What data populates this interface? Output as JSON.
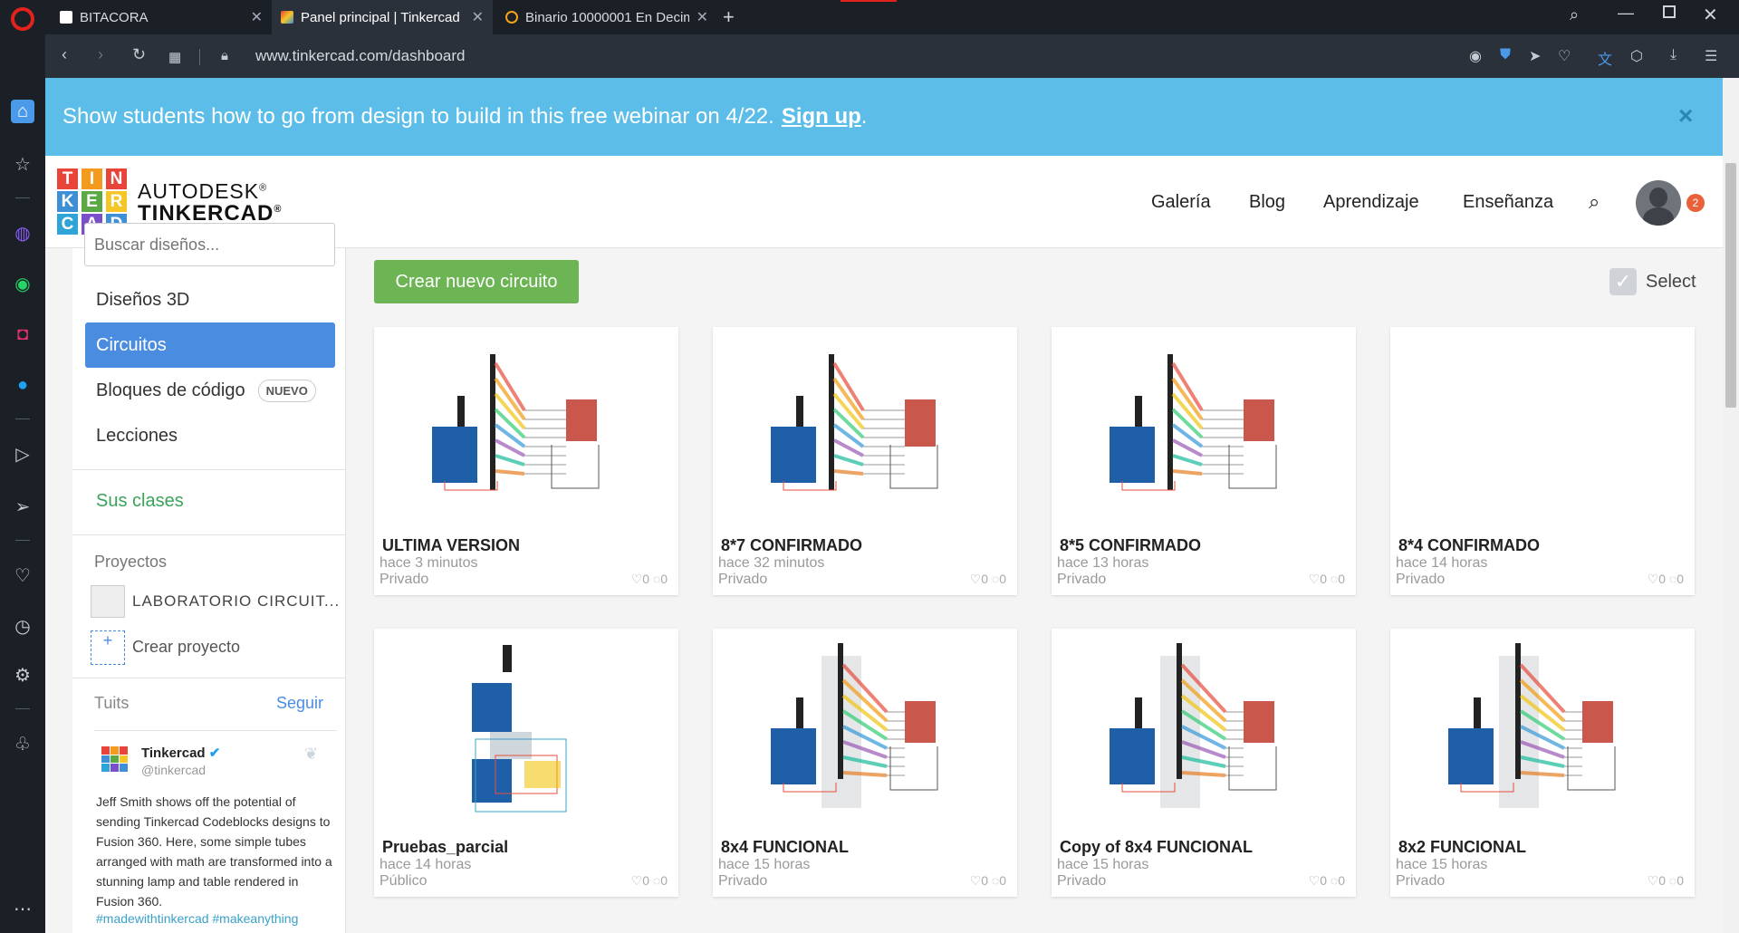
{
  "browser": {
    "tabs": [
      {
        "title": "BITACORA",
        "active": false
      },
      {
        "title": "Panel principal | Tinkercad",
        "active": true
      },
      {
        "title": "Binario 10000001 En Decim",
        "active": false
      }
    ],
    "url": "www.tinkercad.com/dashboard"
  },
  "banner": {
    "text": "Show students how to go from design to build in this free webinar on 4/22.",
    "link": "Sign up",
    "suffix": ".",
    "close": "×"
  },
  "logo": {
    "letters": [
      "T",
      "I",
      "N",
      "K",
      "E",
      "R",
      "C",
      "A",
      "D"
    ],
    "brand_top": "AUTODESK",
    "brand_bottom": "TINKERCAD",
    "reg": "®"
  },
  "nav": {
    "items": [
      "Galería",
      "Blog",
      "Aprendizaje",
      "Enseñanza"
    ],
    "notifications": "2"
  },
  "sidebar": {
    "search_placeholder": "Buscar diseños...",
    "items": [
      {
        "label": "Diseños 3D"
      },
      {
        "label": "Circuitos",
        "active": true
      },
      {
        "label": "Bloques de código",
        "badge": "NUEVO"
      },
      {
        "label": "Lecciones"
      }
    ],
    "classes": "Sus clases",
    "projects_title": "Proyectos",
    "project": "LABORATORIO CIRCUIT...",
    "create_project": "Crear proyecto",
    "tweets_title": "Tuits",
    "follow": "Seguir",
    "tweet": {
      "name": "Tinkercad",
      "handle": "@tinkercad",
      "text": "Jeff Smith shows off the potential of sending Tinkercad Codeblocks designs to Fusion 360. Here, some simple tubes arranged with math are transformed into a stunning lamp and table rendered in Fusion 360.",
      "tags": "#madewithtinkercad #makeanything"
    }
  },
  "main": {
    "create_button": "Crear nuevo circuito",
    "select_label": "Select",
    "cards": [
      {
        "title": "ULTIMA VERSION",
        "time": "hace 3 minutos",
        "visibility": "Privado",
        "likes": "0",
        "comments": "0"
      },
      {
        "title": "8*7 CONFIRMADO",
        "time": "hace 32 minutos",
        "visibility": "Privado",
        "likes": "0",
        "comments": "0"
      },
      {
        "title": "8*5 CONFIRMADO",
        "time": "hace 13 horas",
        "visibility": "Privado",
        "likes": "0",
        "comments": "0"
      },
      {
        "title": "8*4 CONFIRMADO",
        "time": "hace 14 horas",
        "visibility": "Privado",
        "likes": "0",
        "comments": "0"
      },
      {
        "title": "Pruebas_parcial",
        "time": "hace 14 horas",
        "visibility": "Público",
        "likes": "0",
        "comments": "0"
      },
      {
        "title": "8x4 FUNCIONAL",
        "time": "hace 15 horas",
        "visibility": "Privado",
        "likes": "0",
        "comments": "0"
      },
      {
        "title": "Copy of 8x4 FUNCIONAL",
        "time": "hace 15 horas",
        "visibility": "Privado",
        "likes": "0",
        "comments": "0"
      },
      {
        "title": "8x2 FUNCIONAL",
        "time": "hace 15 horas",
        "visibility": "Privado",
        "likes": "0",
        "comments": "0"
      }
    ]
  },
  "colors": {
    "banner": "#5bbde8",
    "active_item": "#4a8de0",
    "create_button": "#6cb454",
    "classes_link": "#3aa35a",
    "logo": [
      "#e8443a",
      "#f39a1f",
      "#f6c526",
      "#5aa944",
      "#3d8fd6",
      "#7b4fc9",
      "#e8443a",
      "#2fa4d6",
      "#5aa944"
    ]
  }
}
